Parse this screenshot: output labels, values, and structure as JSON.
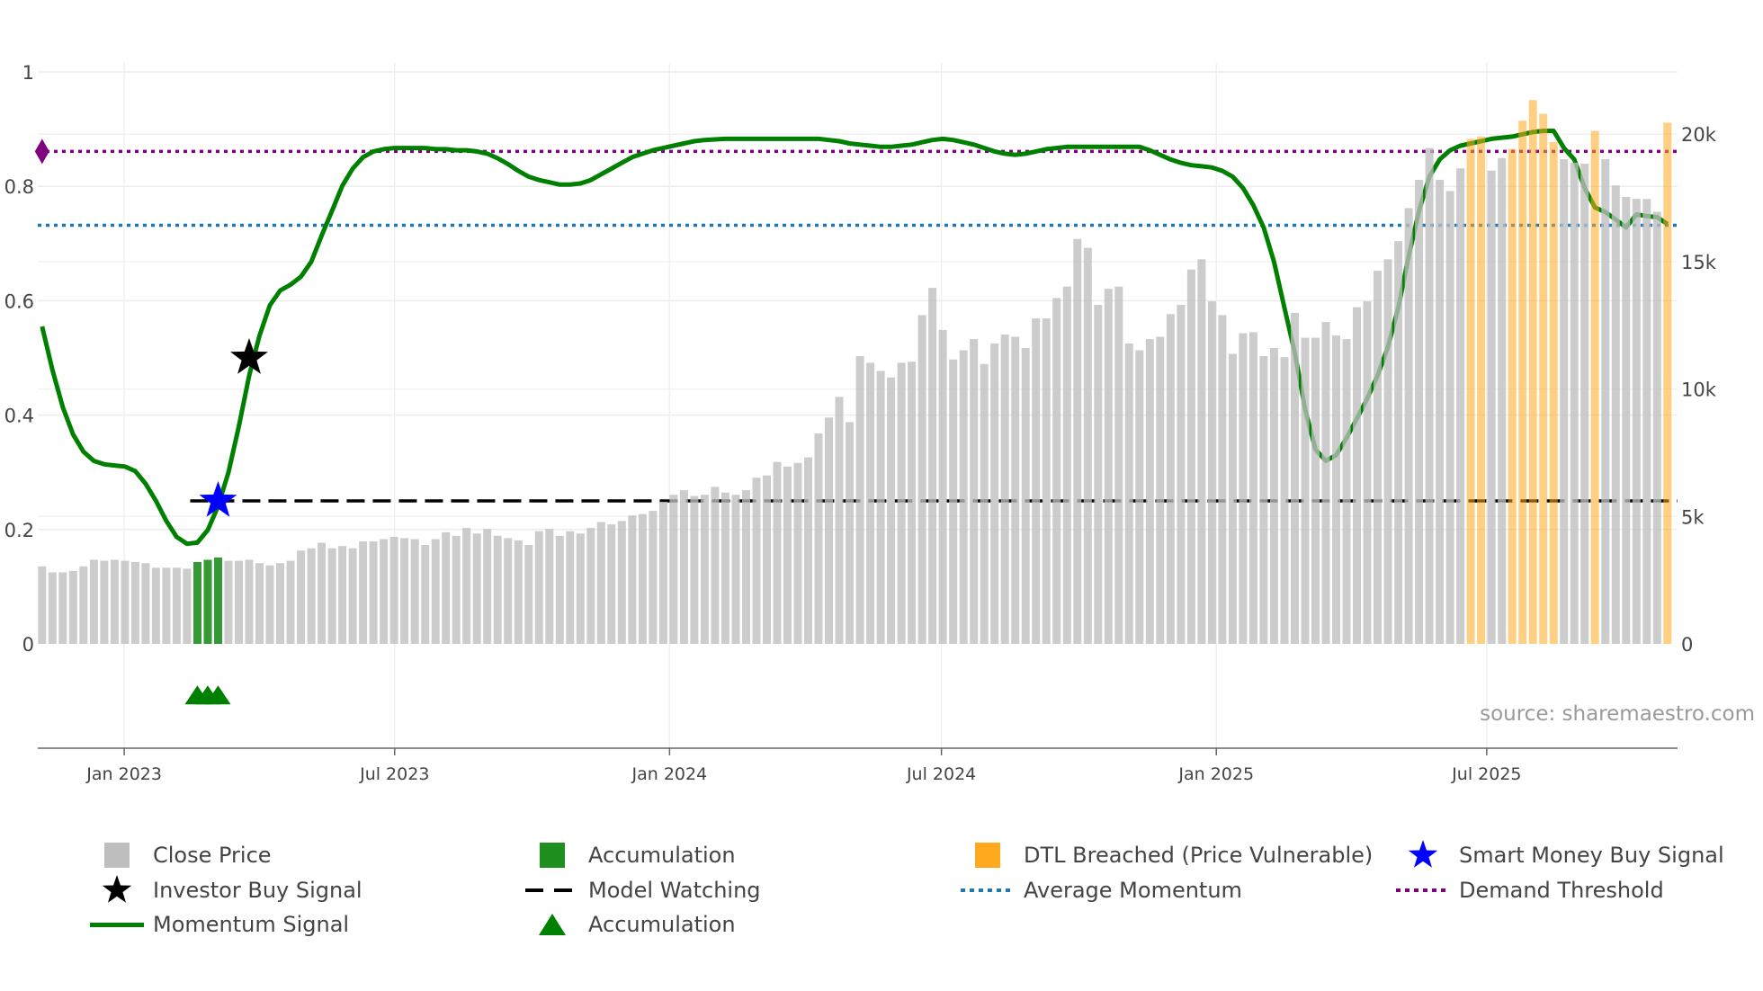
{
  "chart_data": {
    "type": "bar",
    "title": "",
    "source": "source: sharemaestro.com",
    "x_dates": {
      "first_bar": "2022-11-07",
      "last_bar": "2025-10-30"
    },
    "x_ticks": [
      {
        "label": "Jan 2023",
        "date": "2023-01-01"
      },
      {
        "label": "Jul 2023",
        "date": "2023-07-01"
      },
      {
        "label": "Jan 2024",
        "date": "2024-01-01"
      },
      {
        "label": "Jul 2024",
        "date": "2024-07-01"
      },
      {
        "label": "Jan 2025",
        "date": "2025-01-01"
      },
      {
        "label": "Jul 2025",
        "date": "2025-07-01"
      }
    ],
    "left_axis": {
      "range": [
        -0.182,
        1
      ],
      "ticks": [
        {
          "label": "0",
          "value": 0
        },
        {
          "label": "0.2",
          "value": 0.2
        },
        {
          "label": "0.4",
          "value": 0.4
        },
        {
          "label": "0.6",
          "value": 0.6
        },
        {
          "label": "0.8",
          "value": 0.8
        },
        {
          "label": "1",
          "value": 1
        }
      ]
    },
    "right_axis": {
      "range": [
        0,
        22440
      ],
      "ticks": [
        {
          "label": "0",
          "value": 0
        },
        {
          "label": "5k",
          "value": 5000
        },
        {
          "label": "10k",
          "value": 10000
        },
        {
          "label": "15k",
          "value": 15000
        },
        {
          "label": "20k",
          "value": 20000
        }
      ]
    },
    "close_price": [
      3040,
      2810,
      2810,
      2860,
      3040,
      3300,
      3260,
      3300,
      3260,
      3210,
      3170,
      2990,
      2990,
      2990,
      2950,
      3210,
      3300,
      3390,
      3260,
      3260,
      3300,
      3170,
      3080,
      3170,
      3260,
      3660,
      3750,
      3970,
      3750,
      3840,
      3750,
      4020,
      4020,
      4110,
      4200,
      4150,
      4110,
      3880,
      4110,
      4380,
      4240,
      4550,
      4330,
      4510,
      4240,
      4150,
      4060,
      3880,
      4420,
      4510,
      4240,
      4420,
      4330,
      4550,
      4780,
      4690,
      4820,
      5040,
      5090,
      5220,
      5580,
      5850,
      6030,
      5800,
      5850,
      6160,
      5940,
      5850,
      6030,
      6520,
      6610,
      7140,
      6960,
      7100,
      7320,
      8260,
      8880,
      9690,
      8700,
      11290,
      11030,
      10710,
      10450,
      11030,
      11070,
      12900,
      13970,
      12320,
      11160,
      11520,
      11960,
      10980,
      11790,
      12140,
      12050,
      11610,
      12770,
      12770,
      13570,
      14020,
      15890,
      15540,
      13300,
      13930,
      14020,
      11790,
      11520,
      11960,
      12050,
      12940,
      13300,
      14690,
      15090,
      13440,
      12900,
      11380,
      12190,
      12230,
      11290,
      11610,
      11250,
      12990,
      12010,
      12010,
      12630,
      12100,
      11960,
      13210,
      13440,
      14640,
      15090,
      15800,
      17100,
      18210,
      19460,
      18210,
      17770,
      18660,
      19820,
      19910,
      18570,
      19060,
      19420,
      20530,
      21340,
      20800,
      19690,
      19020,
      18880,
      18840,
      20130,
      19020,
      17990,
      17540,
      17460,
      17460,
      16960,
      20450
    ],
    "accumulation_bar_indices": [
      15,
      16,
      17
    ],
    "dtl_breached_bar_indices": [
      138,
      139,
      142,
      143,
      144,
      145,
      146,
      150,
      157
    ],
    "momentum": [
      0.555,
      0.479,
      0.414,
      0.366,
      0.336,
      0.32,
      0.314,
      0.312,
      0.31,
      0.302,
      0.28,
      0.25,
      0.215,
      0.187,
      0.175,
      0.177,
      0.199,
      0.241,
      0.3,
      0.38,
      0.469,
      0.539,
      0.592,
      0.618,
      0.628,
      0.642,
      0.668,
      0.714,
      0.757,
      0.801,
      0.831,
      0.851,
      0.861,
      0.865,
      0.867,
      0.867,
      0.867,
      0.867,
      0.865,
      0.865,
      0.863,
      0.863,
      0.861,
      0.857,
      0.849,
      0.839,
      0.827,
      0.817,
      0.811,
      0.807,
      0.803,
      0.803,
      0.805,
      0.811,
      0.821,
      0.831,
      0.841,
      0.851,
      0.857,
      0.863,
      0.867,
      0.871,
      0.875,
      0.879,
      0.881,
      0.882,
      0.883,
      0.883,
      0.883,
      0.883,
      0.883,
      0.883,
      0.883,
      0.883,
      0.883,
      0.883,
      0.881,
      0.879,
      0.875,
      0.873,
      0.871,
      0.869,
      0.869,
      0.871,
      0.873,
      0.877,
      0.881,
      0.883,
      0.881,
      0.877,
      0.873,
      0.867,
      0.861,
      0.857,
      0.855,
      0.857,
      0.861,
      0.865,
      0.867,
      0.869,
      0.869,
      0.869,
      0.869,
      0.869,
      0.869,
      0.869,
      0.869,
      0.863,
      0.855,
      0.847,
      0.841,
      0.837,
      0.835,
      0.833,
      0.827,
      0.817,
      0.797,
      0.767,
      0.728,
      0.668,
      0.588,
      0.509,
      0.41,
      0.34,
      0.32,
      0.33,
      0.36,
      0.394,
      0.429,
      0.469,
      0.519,
      0.588,
      0.678,
      0.757,
      0.817,
      0.847,
      0.863,
      0.871,
      0.875,
      0.879,
      0.883,
      0.885,
      0.887,
      0.891,
      0.895,
      0.897,
      0.897,
      0.867,
      0.847,
      0.797,
      0.763,
      0.755,
      0.742,
      0.728,
      0.751,
      0.748,
      0.746,
      0.734
    ],
    "demand_threshold": 0.861,
    "average_momentum": 0.732,
    "model_watching": {
      "value": 0.25,
      "start_index": 15
    },
    "smart_money_buy_signal": {
      "index": 17,
      "value": 0.25
    },
    "investor_buy_signal": {
      "index": 20,
      "value": 0.5
    },
    "accumulation_markers": {
      "indices": [
        15,
        16,
        17
      ],
      "value": -0.09
    },
    "colors": {
      "close_price": "#bebebe",
      "accumulation": "#1f8f1f",
      "dtl_breached": "#ffa91f",
      "momentum": "#008000",
      "model_watching": "#000000",
      "average_momentum": "#1f77b4",
      "demand_threshold": "#800080",
      "smart_money": "#0000ff",
      "investor": "#000000"
    },
    "legend": {
      "placement": "bottom",
      "items": [
        {
          "label": "Close Price"
        },
        {
          "label": "Investor Buy Signal"
        },
        {
          "label": "Momentum Signal"
        },
        {
          "label": "Accumulation"
        },
        {
          "label": "Model Watching"
        },
        {
          "label": "Accumulation"
        },
        {
          "label": "DTL Breached (Price Vulnerable)"
        },
        {
          "label": "Average Momentum"
        },
        {
          "label": "Smart Money Buy Signal"
        },
        {
          "label": "Demand Threshold"
        }
      ]
    }
  }
}
